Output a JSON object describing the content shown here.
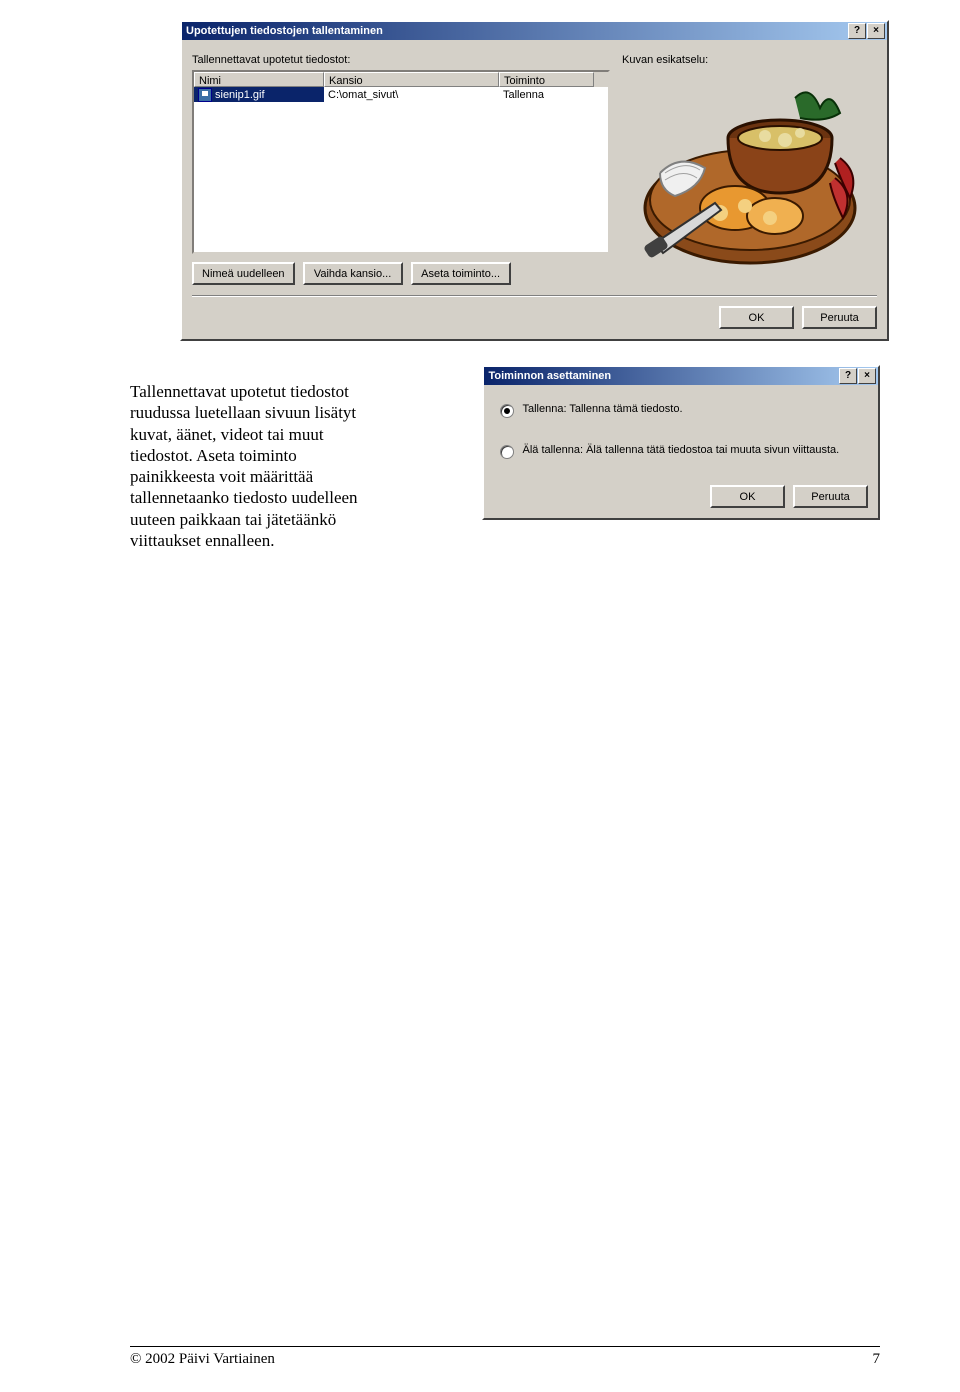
{
  "dialog1": {
    "title": "Upotettujen tiedostojen tallentaminen",
    "label_files": "Tallennettavat upotetut tiedostot:",
    "label_preview": "Kuvan esikatselu:",
    "headers": {
      "name": "Nimi",
      "folder": "Kansio",
      "action": "Toiminto"
    },
    "rows": [
      {
        "name": "sienip1.gif",
        "folder": "C:\\omat_sivut\\",
        "action": "Tallenna"
      }
    ],
    "buttons": {
      "rename": "Nimeä uudelleen",
      "change_folder": "Vaihda kansio...",
      "set_action": "Aseta toiminto..."
    },
    "ok": "OK",
    "cancel": "Peruuta"
  },
  "dialog2": {
    "title": "Toiminnon asettaminen",
    "option_save": "Tallenna: Tallenna tämä tiedosto.",
    "option_dont": "Älä tallenna: Älä tallenna tätä tiedostoa tai muuta sivun viittausta.",
    "ok": "OK",
    "cancel": "Peruuta"
  },
  "doc_paragraph": {
    "l1": "Tallennettavat upotetut tiedostot",
    "l2": "ruudussa luetellaan sivuun lisätyt",
    "l3": "kuvat, äänet, videot tai muut",
    "l4": "tiedostot. Aseta toiminto",
    "l5": "painikkeesta voit määrittää",
    "l6": "tallennetaanko tiedosto uudelleen",
    "l7": "uuteen paikkaan tai jätetäänkö",
    "l8": "viittaukset ennalleen."
  },
  "footer": {
    "copyright": "© 2002 Päivi Vartiainen",
    "page": "7"
  }
}
